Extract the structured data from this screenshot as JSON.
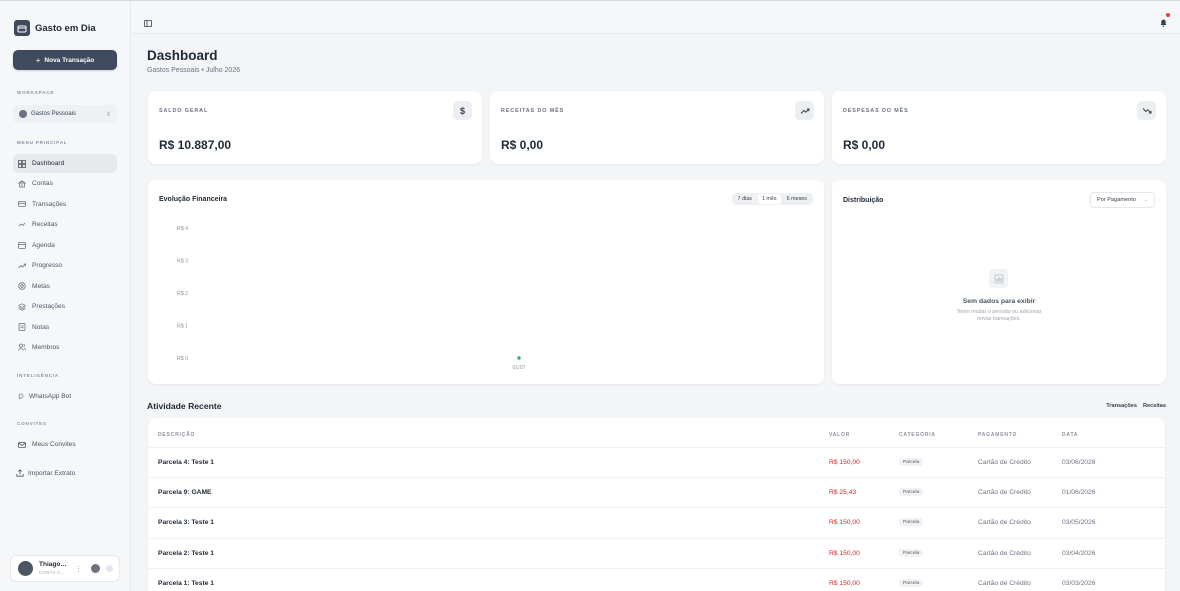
{
  "app": {
    "name": "Gasto em Dia"
  },
  "sidebar": {
    "new_transaction": "Nova Transação",
    "workspace_label": "WORKSPACE",
    "workspace_value": "Gastos Pessoais",
    "menu_label": "MENU PRINCIPAL",
    "items": [
      {
        "label": "Dashboard",
        "icon": "layout-grid-icon"
      },
      {
        "label": "Contas",
        "icon": "bank-icon"
      },
      {
        "label": "Transações",
        "icon": "card-icon"
      },
      {
        "label": "Receitas",
        "icon": "income-icon"
      },
      {
        "label": "Agenda",
        "icon": "calendar-icon"
      },
      {
        "label": "Progresso",
        "icon": "trend-icon"
      },
      {
        "label": "Metas",
        "icon": "target-icon"
      },
      {
        "label": "Prestações",
        "icon": "layers-icon"
      },
      {
        "label": "Notas",
        "icon": "note-icon"
      },
      {
        "label": "Membros",
        "icon": "users-icon"
      }
    ],
    "intel_label": "INTELIGÊNCIA",
    "whatsapp": "WhatsApp Bot",
    "invites_label": "CONVITES",
    "invites": "Meus Convites",
    "import": "Importar Extrato",
    "user": {
      "name": "Thiago…",
      "role": "CONTA A…"
    }
  },
  "header": {
    "title": "Dashboard",
    "subtitle": "Gastos Pessoais • Julho 2026"
  },
  "stats": [
    {
      "label": "SALDO GERAL",
      "value": "R$ 10.887,00",
      "icon": "dollar-icon"
    },
    {
      "label": "RECEITAS DO MÊS",
      "value": "R$ 0,00",
      "icon": "trend-up-icon"
    },
    {
      "label": "DESPESAS DO MÊS",
      "value": "R$ 0,00",
      "icon": "trend-down-icon"
    }
  ],
  "evolution": {
    "title": "Evolução Financeira",
    "ranges": [
      "7 dias",
      "1 mês",
      "6 meses"
    ],
    "active_range": "1 mês"
  },
  "chart_data": {
    "type": "line",
    "title": "Evolução Financeira",
    "x": [
      "01/07"
    ],
    "series": [
      {
        "values": [
          0
        ]
      }
    ],
    "yticks": [
      "R$ 4",
      "R$ 3",
      "R$ 2",
      "R$ 1",
      "R$ 0"
    ],
    "ylim": [
      0,
      4
    ],
    "grid": false
  },
  "distribution": {
    "title": "Distribuição",
    "select": "Por Pagamento",
    "empty_title": "Sem dados para exibir",
    "empty_text": "Tente mudar o período ou adicionar novas transações."
  },
  "recent": {
    "title": "Atividade Recente",
    "links": [
      "Transações",
      "Receitas"
    ],
    "columns": [
      "DESCRIÇÃO",
      "VALOR",
      "CATEGORIA",
      "PAGAMENTO",
      "DATA"
    ],
    "rows": [
      {
        "desc": "Parcela 4: Teste 1",
        "value": "R$ 150,00",
        "cat": "Parcela",
        "pay": "Cartão de Crédito",
        "date": "03/06/2026"
      },
      {
        "desc": "Parcela 9: GAME",
        "value": "R$ 25,43",
        "cat": "Parcela",
        "pay": "Cartão de Crédito",
        "date": "01/06/2026"
      },
      {
        "desc": "Parcela 3: Teste 1",
        "value": "R$ 150,00",
        "cat": "Parcela",
        "pay": "Cartão de Crédito",
        "date": "03/05/2026"
      },
      {
        "desc": "Parcela 2: Teste 1",
        "value": "R$ 150,00",
        "cat": "Parcela",
        "pay": "Cartão de Crédito",
        "date": "03/04/2026"
      },
      {
        "desc": "Parcela 1: Teste 1",
        "value": "R$ 150,00",
        "cat": "Parcela",
        "pay": "Cartão de Crédito",
        "date": "03/03/2026"
      }
    ]
  }
}
